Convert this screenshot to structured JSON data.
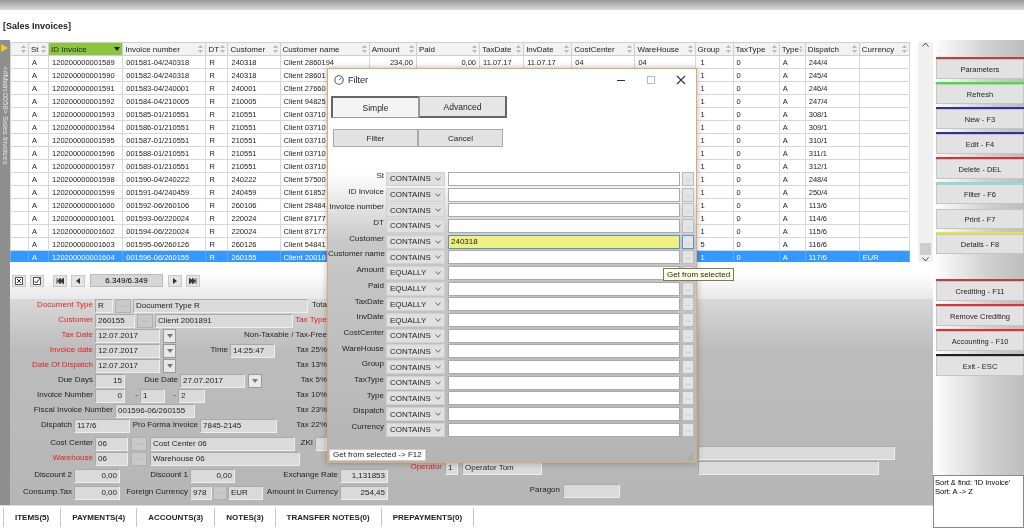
{
  "window": {
    "title": "[Sales Invoices]",
    "sidebar_label": "<#Main:0058> Sales Invoices"
  },
  "table": {
    "columns": [
      {
        "label": "St",
        "sorted": false
      },
      {
        "label": "ID Invoice",
        "sorted": true
      },
      {
        "label": "Invoice number",
        "sorted": false
      },
      {
        "label": "DT",
        "sorted": false
      },
      {
        "label": "Customer",
        "sorted": false
      },
      {
        "label": "Customer name",
        "sorted": false
      },
      {
        "label": "Amount",
        "sorted": false
      },
      {
        "label": "Paid",
        "sorted": false
      },
      {
        "label": "TaxDate",
        "sorted": false
      },
      {
        "label": "InvDate",
        "sorted": false
      },
      {
        "label": "CostCenter",
        "sorted": false
      },
      {
        "label": "WareHouse",
        "sorted": false
      },
      {
        "label": "Group",
        "sorted": false
      },
      {
        "label": "TaxType",
        "sorted": false
      },
      {
        "label": "Type",
        "sorted": false
      },
      {
        "label": "Dispatch",
        "sorted": false
      },
      {
        "label": "Currency",
        "sorted": false
      }
    ],
    "rows": [
      {
        "selected": false,
        "cells": [
          "A",
          "120200000001589",
          "001581-04/240318",
          "R",
          "240318",
          "Client 2860194",
          "234,00",
          "0,00",
          "11.07.17",
          "11.07.17",
          "04",
          "04",
          "1",
          "0",
          "A",
          "244/4"
        ]
      },
      {
        "selected": false,
        "cells": [
          "A",
          "120200000001590",
          "001582-04/240318",
          "R",
          "240318",
          "Client 28601",
          null,
          null,
          null,
          null,
          null,
          null,
          "1",
          "0",
          "A",
          "245/4"
        ]
      },
      {
        "selected": false,
        "cells": [
          "A",
          "120200000001591",
          "001583-04/240001",
          "R",
          "240001",
          "Client 27660",
          null,
          null,
          null,
          null,
          null,
          null,
          "1",
          "0",
          "A",
          "246/4"
        ]
      },
      {
        "selected": false,
        "cells": [
          "A",
          "120200000001592",
          "001584-04/210005",
          "R",
          "210005",
          "Client 94825",
          null,
          null,
          null,
          null,
          null,
          null,
          "1",
          "0",
          "A",
          "247/4"
        ]
      },
      {
        "selected": false,
        "cells": [
          "A",
          "120200000001593",
          "001585-01/210551",
          "R",
          "210551",
          "Client 03710",
          null,
          null,
          null,
          null,
          null,
          null,
          "1",
          "0",
          "A",
          "308/1"
        ]
      },
      {
        "selected": false,
        "cells": [
          "A",
          "120200000001594",
          "001586-01/210551",
          "R",
          "210551",
          "Client 03710",
          null,
          null,
          null,
          null,
          null,
          null,
          "1",
          "0",
          "A",
          "309/1"
        ]
      },
      {
        "selected": false,
        "cells": [
          "A",
          "120200000001595",
          "001587-01/210551",
          "R",
          "210551",
          "Client 03710",
          null,
          null,
          null,
          null,
          null,
          null,
          "1",
          "0",
          "A",
          "310/1"
        ]
      },
      {
        "selected": false,
        "cells": [
          "A",
          "120200000001596",
          "001588-01/210551",
          "R",
          "210551",
          "Client 03710",
          null,
          null,
          null,
          null,
          null,
          null,
          "1",
          "0",
          "A",
          "311/1"
        ]
      },
      {
        "selected": false,
        "cells": [
          "A",
          "120200000001597",
          "001589-01/210551",
          "R",
          "210551",
          "Client 03710",
          null,
          null,
          null,
          null,
          null,
          null,
          "1",
          "0",
          "A",
          "312/1"
        ]
      },
      {
        "selected": false,
        "cells": [
          "A",
          "120200000001598",
          "001590-04/240222",
          "R",
          "240222",
          "Client 57500",
          null,
          null,
          null,
          null,
          null,
          null,
          "1",
          "0",
          "A",
          "248/4"
        ]
      },
      {
        "selected": false,
        "cells": [
          "A",
          "120200000001599",
          "001591-04/240459",
          "R",
          "240459",
          "Client 61852",
          null,
          null,
          null,
          null,
          null,
          null,
          "1",
          "0",
          "A",
          "250/4"
        ]
      },
      {
        "selected": false,
        "cells": [
          "A",
          "120200000001600",
          "001592-06/260106",
          "R",
          "260106",
          "Client 28484",
          null,
          null,
          null,
          null,
          null,
          null,
          "1",
          "0",
          "A",
          "113/6"
        ]
      },
      {
        "selected": false,
        "cells": [
          "A",
          "120200000001601",
          "001593-06/220024",
          "R",
          "220024",
          "Client 87177",
          null,
          null,
          null,
          null,
          null,
          null,
          "1",
          "0",
          "A",
          "114/6"
        ]
      },
      {
        "selected": false,
        "cells": [
          "A",
          "120200000001602",
          "001594-06/220024",
          "R",
          "220024",
          "Client 87177",
          null,
          null,
          null,
          null,
          null,
          null,
          "1",
          "0",
          "A",
          "115/6"
        ]
      },
      {
        "selected": false,
        "cells": [
          "A",
          "120200000001603",
          "001595-06/260126",
          "R",
          "260126",
          "Client 54841",
          null,
          null,
          null,
          null,
          null,
          null,
          "5",
          "0",
          "A",
          "116/6"
        ]
      },
      {
        "selected": true,
        "cells": [
          "A",
          "120200000001604",
          "001596-06/260155",
          "R",
          "260155",
          "Client 20018",
          null,
          null,
          null,
          null,
          null,
          null,
          "1",
          "0",
          "A",
          "117/6",
          "EUR"
        ]
      }
    ]
  },
  "navigator": {
    "record": "6.349/6.349"
  },
  "form": {
    "rows": [
      {
        "items": [
          {
            "kind": "label",
            "text": "Document Type",
            "required": true
          },
          {
            "kind": "field",
            "value": "R"
          },
          {
            "kind": "lookup"
          },
          {
            "kind": "field",
            "value": "Document Type R"
          },
          {
            "kind": "label",
            "text": "Tota",
            "required": false
          }
        ]
      },
      {
        "items": [
          {
            "kind": "label",
            "text": "Customer",
            "required": true
          },
          {
            "kind": "field",
            "value": "260155"
          },
          {
            "kind": "lookup"
          },
          {
            "kind": "field",
            "value": "Client 2001891"
          },
          {
            "kind": "label",
            "text": "Tax Type",
            "required": true
          }
        ]
      },
      {
        "items": [
          {
            "kind": "label",
            "text": "Tax Date",
            "required": true
          },
          {
            "kind": "field",
            "value": "12.07.2017"
          },
          {
            "kind": "dropdown"
          },
          {
            "kind": "label",
            "text": "Non-Taxable / Tax-Free",
            "required": false
          }
        ]
      },
      {
        "items": [
          {
            "kind": "label",
            "text": "Invoice date",
            "required": true
          },
          {
            "kind": "field",
            "value": "12.07.2017"
          },
          {
            "kind": "dropdown"
          },
          {
            "kind": "label",
            "text": "Time",
            "required": false
          },
          {
            "kind": "field",
            "value": "14:25:47"
          },
          {
            "kind": "label",
            "text": "Tax 25%",
            "required": false
          }
        ]
      },
      {
        "items": [
          {
            "kind": "label",
            "text": "Date Of Dispatch",
            "required": true
          },
          {
            "kind": "field",
            "value": "12.07.2017"
          },
          {
            "kind": "dropdown"
          },
          {
            "kind": "label",
            "text": "Tax 13%",
            "required": false
          }
        ]
      },
      {
        "items": [
          {
            "kind": "label",
            "text": "Due Days",
            "required": false
          },
          {
            "kind": "field",
            "value": "15"
          },
          {
            "kind": "label",
            "text": "Due Date",
            "required": false
          },
          {
            "kind": "field",
            "value": "27.07.2017"
          },
          {
            "kind": "dropdown"
          },
          {
            "kind": "label",
            "text": "Tax 5%",
            "required": false
          }
        ]
      },
      {
        "items": [
          {
            "kind": "label",
            "text": "Invoice Number",
            "required": false
          },
          {
            "kind": "field",
            "value": "0"
          },
          {
            "kind": "label",
            "text": "-",
            "required": false
          },
          {
            "kind": "field",
            "value": "1"
          },
          {
            "kind": "label",
            "text": "-",
            "required": false
          },
          {
            "kind": "field",
            "value": "2"
          },
          {
            "kind": "label",
            "text": "Tax 10%",
            "required": false
          }
        ]
      },
      {
        "items": [
          {
            "kind": "label",
            "text": "Fiscal Invoice Number",
            "required": false
          },
          {
            "kind": "field",
            "value": "001596-06/260155"
          },
          {
            "kind": "label",
            "text": "Tax 23%",
            "required": false
          }
        ]
      },
      {
        "items": [
          {
            "kind": "label",
            "text": "Dispatch",
            "required": false
          },
          {
            "kind": "field",
            "value": "117/6"
          },
          {
            "kind": "label",
            "text": "Pro Forma Invoice",
            "required": false
          },
          {
            "kind": "field",
            "value": "7845-2145"
          },
          {
            "kind": "label",
            "text": "Tax 22%",
            "required": false
          }
        ]
      },
      {
        "items": [
          {
            "kind": "label",
            "text": "Cost Center",
            "required": false
          },
          {
            "kind": "field",
            "value": "06"
          },
          {
            "kind": "lookup"
          },
          {
            "kind": "field",
            "value": "Cost Center 06"
          },
          {
            "kind": "label",
            "text": "ZKI",
            "required": false
          },
          {
            "kind": "field"
          }
        ]
      },
      {
        "items": [
          {
            "kind": "label",
            "text": "Warehouse",
            "required": true
          },
          {
            "kind": "field",
            "value": "06"
          },
          {
            "kind": "lookup"
          },
          {
            "kind": "field",
            "value": "Warehouse 06"
          }
        ]
      },
      {
        "items": [
          {
            "kind": "label",
            "text": "Discount 2",
            "required": false
          },
          {
            "kind": "field",
            "value": "0,00"
          },
          {
            "kind": "label",
            "text": "Discount 1",
            "required": false
          },
          {
            "kind": "field",
            "value": "0,00"
          },
          {
            "kind": "label",
            "text": "Exchange Rate",
            "required": false
          },
          {
            "kind": "field",
            "value": "1,131853"
          }
        ]
      },
      {
        "items": [
          {
            "kind": "label",
            "text": "Consump.Tax",
            "required": false
          },
          {
            "kind": "field",
            "value": "0,00"
          },
          {
            "kind": "label",
            "text": "Foreign Currency",
            "required": false
          },
          {
            "kind": "field",
            "value": "978"
          },
          {
            "kind": "lookup"
          },
          {
            "kind": "field",
            "value": "EUR"
          },
          {
            "kind": "label",
            "text": "Amount In Currency",
            "required": false
          },
          {
            "kind": "field",
            "value": "254,45"
          }
        ]
      }
    ],
    "side_rows": [
      {
        "items": [
          {
            "kind": "field"
          }
        ]
      },
      {
        "items": [
          {
            "kind": "label",
            "text": "Operator",
            "required": true
          },
          {
            "kind": "field",
            "value": "1"
          },
          {
            "kind": "field",
            "value": "Operator Tom"
          },
          {
            "kind": "field"
          }
        ]
      },
      {
        "items": [
          {
            "kind": "label",
            "text": "Paragon",
            "required": false
          },
          {
            "kind": "field"
          }
        ]
      }
    ]
  },
  "tabs": [
    {
      "label": "ITEMS(5)",
      "selected": false
    },
    {
      "label": "PAYMENTS(4)",
      "selected": false
    },
    {
      "label": "ACCOUNTS(3)",
      "selected": false
    },
    {
      "label": "NOTES(3)",
      "selected": false
    },
    {
      "label": "TRANSFER NOTES(0)",
      "selected": false
    },
    {
      "label": "PREPAYMENTS(0)",
      "selected": false
    }
  ],
  "actions": [
    {
      "label": "Parameters",
      "color": "#c04040"
    },
    {
      "label": "Refresh",
      "color": "#40e040"
    },
    {
      "label": "New - F3",
      "color": "#3030a0"
    },
    {
      "label": "Edit - F4",
      "color": "#3030a0"
    },
    {
      "label": "Delete - DEL",
      "color": "#e03030"
    },
    {
      "label": "Filter - F6",
      "color": "#80e0e0"
    },
    {
      "label": "Print - F7"
    },
    {
      "label": "Details - F8",
      "color": "#e8e040"
    },
    {
      "label": "Crediting - F11",
      "color": "#c04040"
    },
    {
      "label": "Remove Crediting",
      "color": "#e03030"
    },
    {
      "label": "Accounting - F10",
      "color": "#e03030"
    },
    {
      "label": "Exit - ESC",
      "color": "#202020"
    }
  ],
  "sort_info": [
    "Sort & find: 'ID Invoice'",
    "Sort: A -> Z"
  ],
  "filter_dialog": {
    "title": "Filter",
    "tabs": [
      {
        "label": "Simple",
        "selected": true
      },
      {
        "label": "Advanced",
        "selected": false
      }
    ],
    "buttons": [
      "Filter",
      "Cancel"
    ],
    "rows": [
      {
        "label": "St",
        "operator": "CONTAINS",
        "focused": false
      },
      {
        "label": "ID Invoice",
        "operator": "CONTAINS",
        "focused": false
      },
      {
        "label": "Invoice number",
        "operator": "CONTAINS",
        "focused": false
      },
      {
        "label": "DT",
        "operator": "CONTAINS",
        "focused": false
      },
      {
        "label": "Customer",
        "operator": "CONTAINS",
        "value": "240318",
        "focused": true
      },
      {
        "label": "Customer name",
        "operator": "CONTAINS",
        "focused": false
      },
      {
        "label": "Amount",
        "operator": "EQUALLY",
        "focused": false
      },
      {
        "label": "Paid",
        "operator": "EQUALLY",
        "focused": false
      },
      {
        "label": "TaxDate",
        "operator": "EQUALLY",
        "focused": false
      },
      {
        "label": "InvDate",
        "operator": "EQUALLY",
        "focused": false
      },
      {
        "label": "CostCenter",
        "operator": "CONTAINS",
        "focused": false
      },
      {
        "label": "WareHouse",
        "operator": "CONTAINS",
        "focused": false
      },
      {
        "label": "Group",
        "operator": "CONTAINS",
        "focused": false
      },
      {
        "label": "TaxType",
        "operator": "CONTAINS",
        "focused": false
      },
      {
        "label": "Type",
        "operator": "CONTAINS",
        "focused": false
      },
      {
        "label": "Dispatch",
        "operator": "CONTAINS",
        "focused": false
      },
      {
        "label": "Currency",
        "operator": "CONTAINS",
        "focused": false
      }
    ],
    "lookup_text": "...",
    "tooltip": "Get from selected",
    "status": "Get from selected -> F12"
  }
}
